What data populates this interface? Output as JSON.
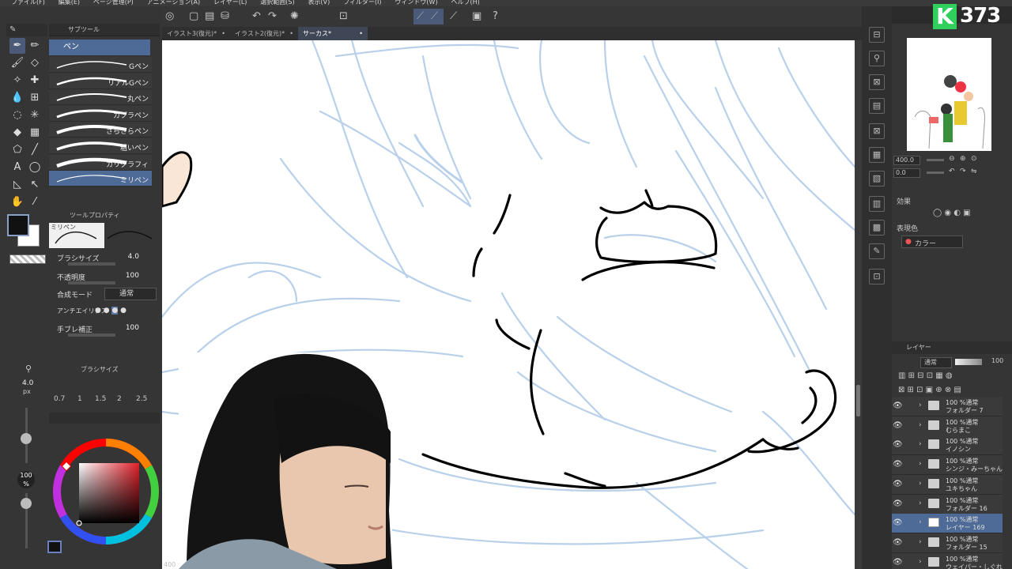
{
  "menu": [
    "ファイル(F)",
    "編集(E)",
    "ページ管理(P)",
    "アニメーション(A)",
    "レイヤー(L)",
    "選択範囲(S)",
    "表示(V)",
    "フィルター(I)",
    "ウィンドウ(W)",
    "ヘルプ(H)"
  ],
  "tabs": [
    "イラスト3(復元)*",
    "イラスト2(復元)*",
    "サーカス*"
  ],
  "subtool": {
    "header": "サブツール",
    "active": "ペン",
    "brushes": [
      "Gペン",
      "リアルGペン",
      "丸ペン",
      "カブラペン",
      "さらさらペン",
      "粗いペン",
      "カリグラフィ",
      "ミリペン"
    ]
  },
  "tool_property": {
    "header": "ツールプロパティ",
    "preview_label": "ミリペン",
    "rows": [
      {
        "label": "ブラシサイズ",
        "value": "4.0"
      },
      {
        "label": "不透明度",
        "value": "100"
      },
      {
        "label": "合成モード",
        "value": "通常"
      },
      {
        "label": "アンチエイリアス",
        "value": ""
      },
      {
        "label": "手ブレ補正",
        "value": "100"
      }
    ]
  },
  "brush_size": {
    "header": "ブラシサイズ",
    "current": "4.0",
    "unit": "px",
    "options": [
      "0.7",
      "1",
      "1.5",
      "2",
      "2.5"
    ],
    "opacity_value": "100",
    "opacity_unit": "%"
  },
  "color": {
    "main": "#111111",
    "sub": "#ffffff"
  },
  "navigator": {
    "zoom": "400.0",
    "angle": "0.0"
  },
  "effects": {
    "header": "効果",
    "expression_label": "表現色",
    "expression_value": "カラー"
  },
  "layers": {
    "header": "レイヤー",
    "blend": "通常",
    "opacity": "100",
    "items": [
      {
        "pct": "100 %通常",
        "name": "フォルダー 7",
        "selected": false
      },
      {
        "pct": "100 %通常",
        "name": "むらまこ",
        "selected": false
      },
      {
        "pct": "100 %通常",
        "name": "イノシン",
        "selected": false
      },
      {
        "pct": "100 %通常",
        "name": "シンジ・みーちゃん",
        "selected": false
      },
      {
        "pct": "100 %通常",
        "name": "ユキちゃん",
        "selected": false
      },
      {
        "pct": "100 %通常",
        "name": "フォルダー 16",
        "selected": false
      },
      {
        "pct": "100 %通常",
        "name": "レイヤー 169",
        "selected": true
      },
      {
        "pct": "100 %通常",
        "name": "フォルダー 15",
        "selected": false
      },
      {
        "pct": "100 %通常",
        "name": "ウェイパー・しぐれ",
        "selected": false
      }
    ]
  },
  "status": {
    "zoom": "400"
  },
  "logo": {
    "letter": "K",
    "number": "373"
  }
}
